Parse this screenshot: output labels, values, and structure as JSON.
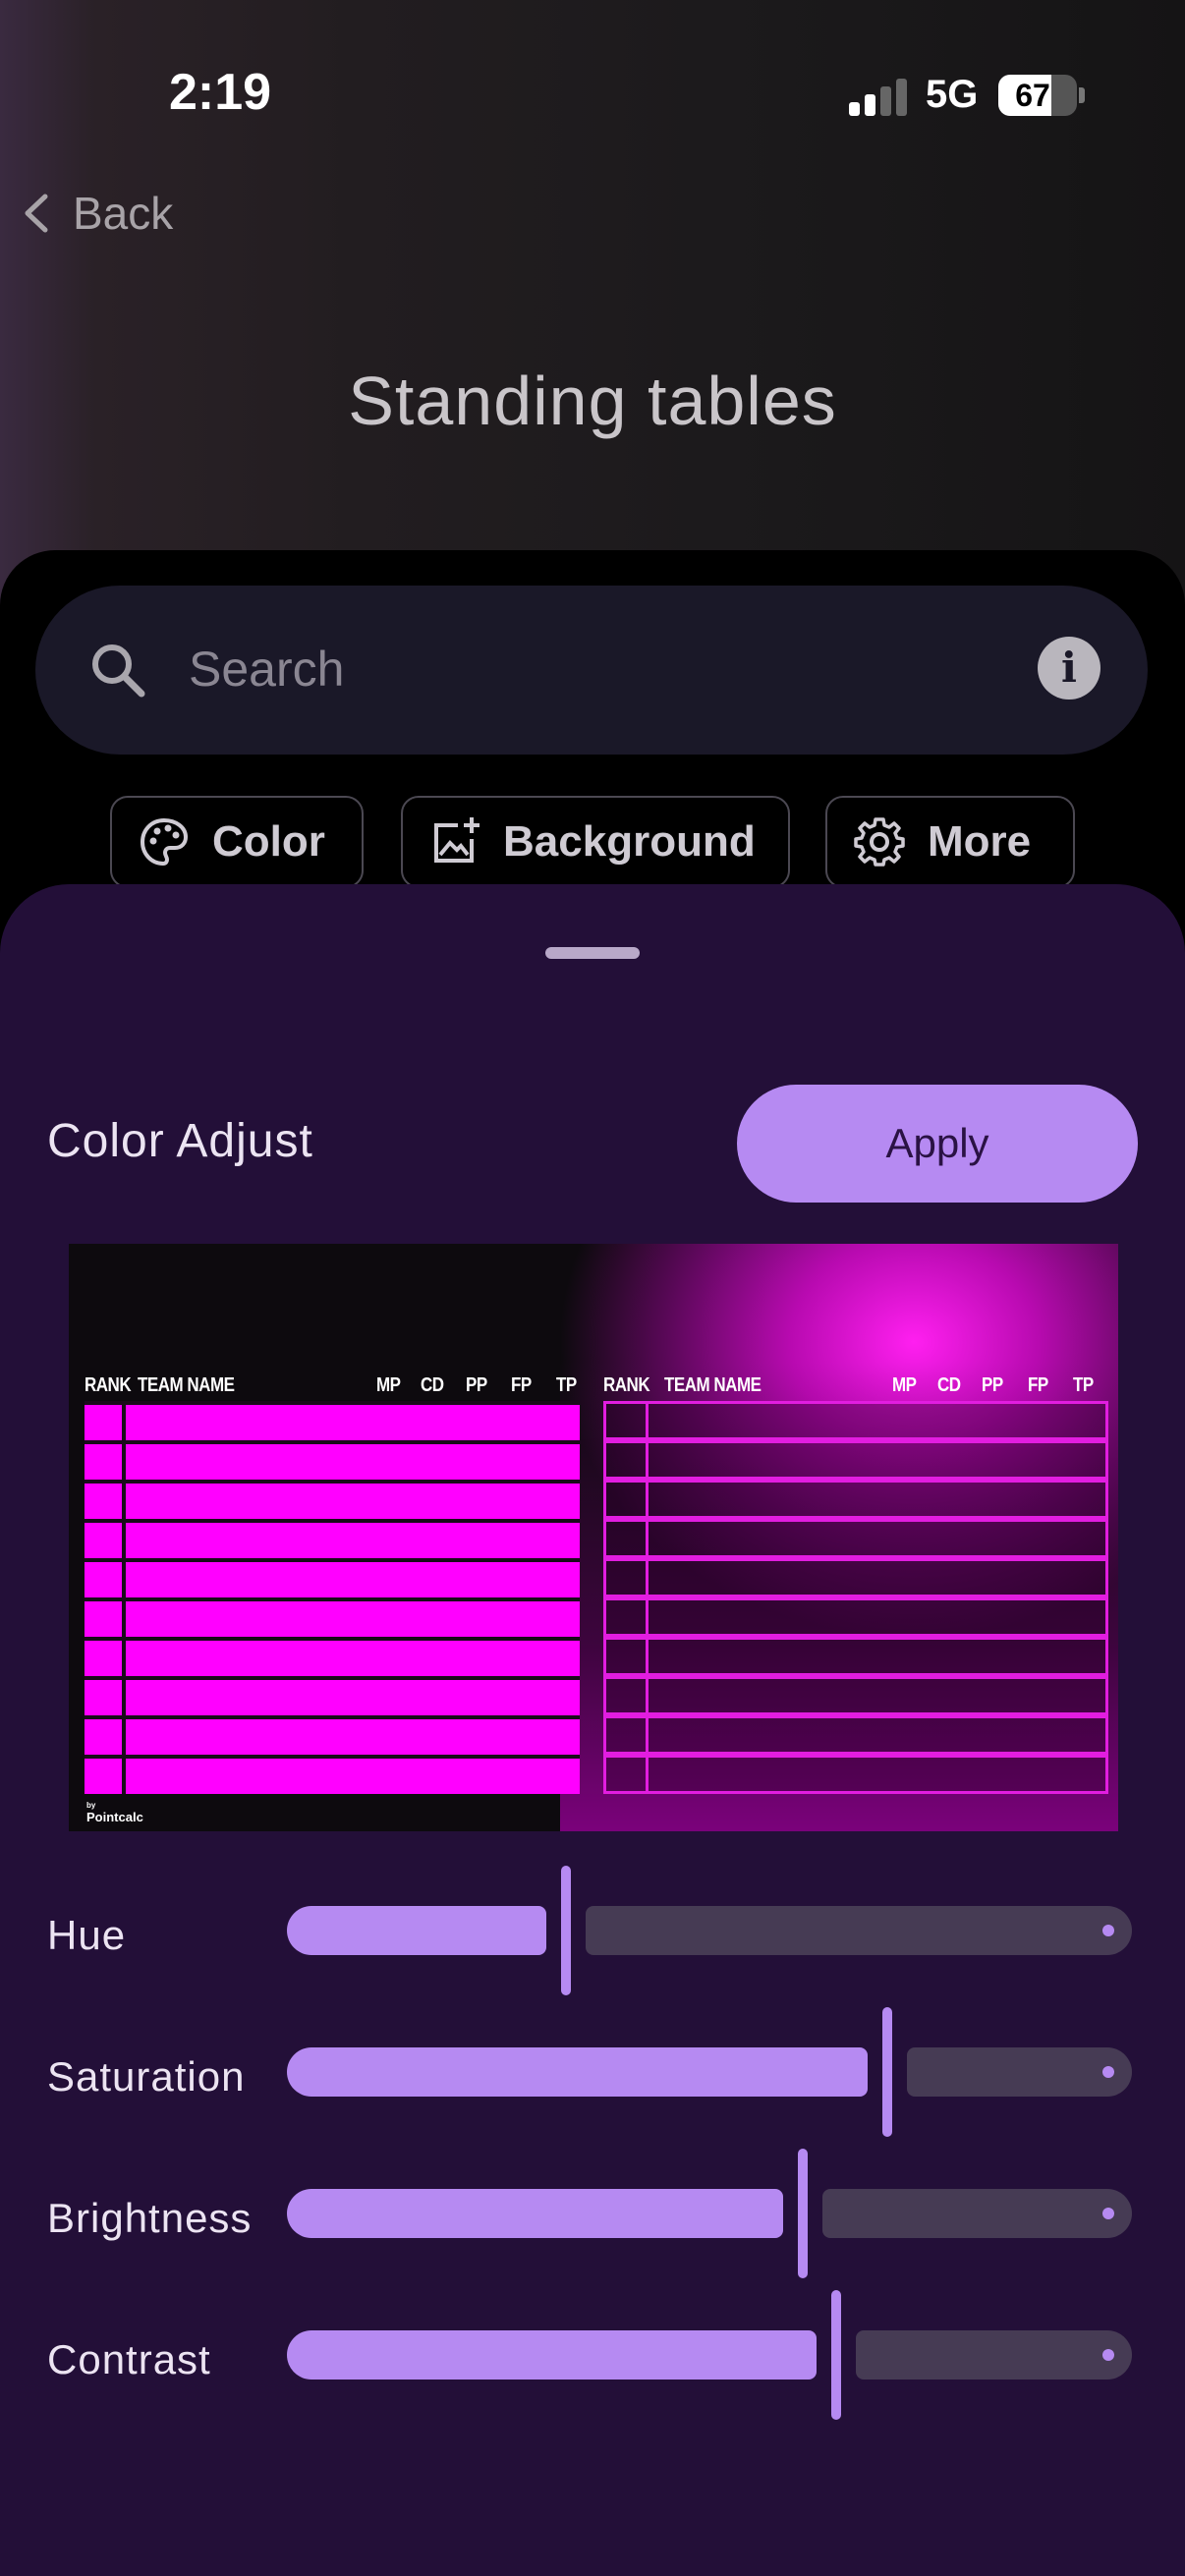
{
  "status_bar": {
    "time": "2:19",
    "network": "5G",
    "battery": "67"
  },
  "nav": {
    "back_label": "Back",
    "title": "Standing tables"
  },
  "search": {
    "placeholder": "Search",
    "info_glyph": "i"
  },
  "chips": [
    {
      "label": "Color",
      "icon": "palette-icon"
    },
    {
      "label": "Background",
      "icon": "add-image-icon"
    },
    {
      "label": "More",
      "icon": "gear-icon"
    }
  ],
  "sheet": {
    "title": "Color Adjust",
    "apply_label": "Apply"
  },
  "preview": {
    "left_headers": [
      "RANK",
      "TEAM NAME",
      "MP",
      "CD",
      "PP",
      "FP",
      "TP"
    ],
    "right_headers": [
      "RANK",
      "TEAM NAME",
      "MP",
      "CD",
      "PP",
      "FP",
      "TP"
    ],
    "credit_by": "by",
    "credit_name": "Pointcalc",
    "rows": 10
  },
  "sliders": [
    {
      "label": "Hue",
      "value": 0.33
    },
    {
      "label": "Saturation",
      "value": 0.71
    },
    {
      "label": "Brightness",
      "value": 0.61
    },
    {
      "label": "Contrast",
      "value": 0.65
    }
  ],
  "colors": {
    "accent": "#b68af2",
    "sheet_bg": "#230f38",
    "magenta": "#ff00ff"
  }
}
